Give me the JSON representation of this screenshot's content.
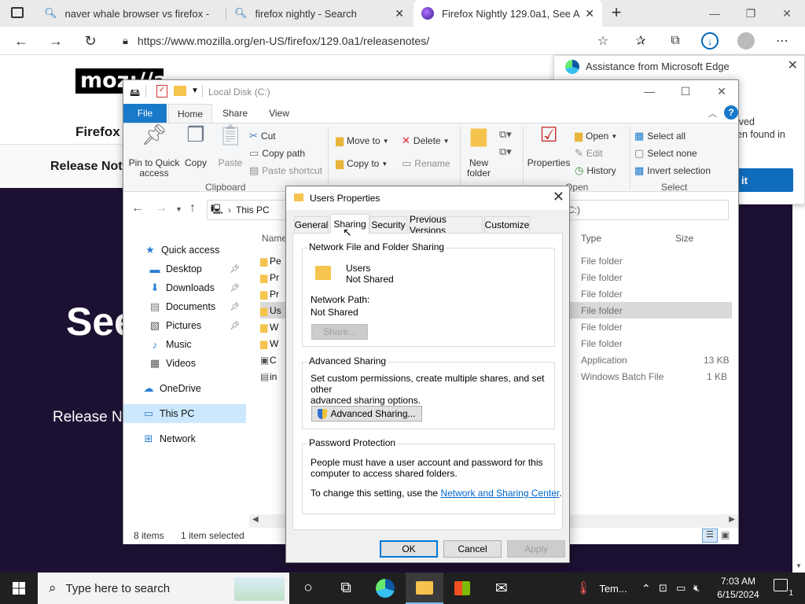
{
  "browser": {
    "tabs": [
      {
        "label": "naver whale browser vs firefox -"
      },
      {
        "label": "firefox nightly - Search"
      },
      {
        "label": "Firefox Nightly 129.0a1, See All N"
      }
    ],
    "url": "https://www.mozilla.org/en-US/firefox/129.0a1/releasenotes/"
  },
  "webpage": {
    "logo": "moz://a",
    "heading": "Firefox N",
    "subnav": "Release Not",
    "hero_title": "See",
    "hero_sub": "Release No"
  },
  "edge_panel": {
    "title": "Assistance from Microsoft Edge",
    "text_line1": "lved",
    "text_line2": "en found in",
    "button": "it"
  },
  "explorer": {
    "title": "Local Disk (C:)",
    "ribbon_tabs": [
      "File",
      "Home",
      "Share",
      "View"
    ],
    "clipboard": {
      "pin": "Pin to Quick access",
      "copy": "Copy",
      "paste": "Paste",
      "cut": "Cut",
      "copy_path": "Copy path",
      "paste_shortcut": "Paste shortcut",
      "label": "Clipboard"
    },
    "organize": {
      "move_to": "Move to",
      "copy_to": "Copy to",
      "delete": "Delete",
      "rename": "Rename",
      "label": "Organize"
    },
    "new": {
      "new_folder": "New folder",
      "label": "New"
    },
    "open": {
      "properties": "Properties",
      "open": "Open",
      "edit": "Edit",
      "history": "History",
      "label": "Open"
    },
    "select": {
      "select_all": "Select all",
      "select_none": "Select none",
      "invert": "Invert selection",
      "label": "Select"
    },
    "breadcrumb": "This PC",
    "address_tail": "C:)",
    "nav": [
      {
        "label": "Quick access",
        "icon": "star-icon"
      },
      {
        "label": "Desktop",
        "icon": "desktop-icon",
        "pinned": true
      },
      {
        "label": "Downloads",
        "icon": "download-icon",
        "pinned": true
      },
      {
        "label": "Documents",
        "icon": "document-icon",
        "pinned": true
      },
      {
        "label": "Pictures",
        "icon": "picture-icon",
        "pinned": true
      },
      {
        "label": "Music",
        "icon": "music-icon"
      },
      {
        "label": "Videos",
        "icon": "video-icon"
      },
      {
        "label": "OneDrive",
        "icon": "cloud-icon"
      },
      {
        "label": "This PC",
        "icon": "computer-icon",
        "selected": true
      },
      {
        "label": "Network",
        "icon": "network-icon"
      }
    ],
    "columns": {
      "name": "Name",
      "type": "Type",
      "size": "Size"
    },
    "files": [
      {
        "name": "Pe",
        "type": "File folder",
        "size": ""
      },
      {
        "name": "Pr",
        "type": "File folder",
        "size": ""
      },
      {
        "name": "Pr",
        "type": "File folder",
        "size": ""
      },
      {
        "name": "Us",
        "type": "File folder",
        "size": "",
        "selected": true
      },
      {
        "name": "W",
        "type": "File folder",
        "size": ""
      },
      {
        "name": "W",
        "type": "File folder",
        "size": ""
      },
      {
        "name": "C",
        "type": "Application",
        "size": "13 KB"
      },
      {
        "name": "in",
        "type": "Windows Batch File",
        "size": "1 KB"
      }
    ],
    "status_count": "8 items",
    "status_selected": "1 item selected"
  },
  "dialog": {
    "title": "Users Properties",
    "tabs": [
      "General",
      "Sharing",
      "Security",
      "Previous Versions",
      "Customize"
    ],
    "active_tab": "Sharing",
    "network_sharing": {
      "label": "Network File and Folder Sharing",
      "folder_name": "Users",
      "folder_status": "Not Shared",
      "path_label": "Network Path:",
      "path_value": "Not Shared",
      "share_button": "Share..."
    },
    "advanced": {
      "label": "Advanced Sharing",
      "desc_line1": "Set custom permissions, create multiple shares, and set other",
      "desc_line2": "advanced sharing options.",
      "button": "Advanced Sharing..."
    },
    "password": {
      "label": "Password Protection",
      "desc_line1": "People must have a user account and password for this",
      "desc_line2": "computer to access shared folders.",
      "change_prefix": "To change this setting, use the ",
      "link": "Network and Sharing Center",
      "change_suffix": "."
    },
    "buttons": {
      "ok": "OK",
      "cancel": "Cancel",
      "apply": "Apply"
    }
  },
  "taskbar": {
    "search_placeholder": "Type here to search",
    "weather": "Tem...",
    "time": "7:03 AM",
    "date": "6/15/2024",
    "notifications": "1"
  },
  "colors": {
    "accent": "#0078d7",
    "hero_bg": "#1d1133",
    "file_tab": "#1979ca",
    "selected_nav": "#cce8ff"
  }
}
